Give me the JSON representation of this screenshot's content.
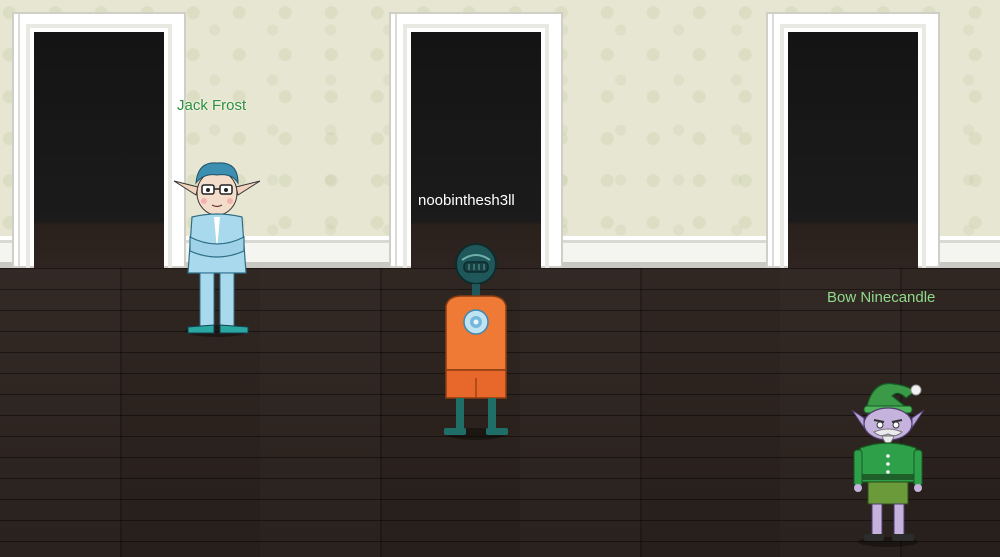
{
  "players": [
    {
      "name": "Jack Frost"
    },
    {
      "name": "noobinthesh3ll"
    },
    {
      "name": "Bow Ninecandle"
    }
  ],
  "colors": {
    "wall": "#e7e6d2",
    "floor": "#2a201c",
    "jack_tag": "#2a8f37",
    "player_tag": "#ffffff",
    "bow_tag": "#8fd98b"
  }
}
